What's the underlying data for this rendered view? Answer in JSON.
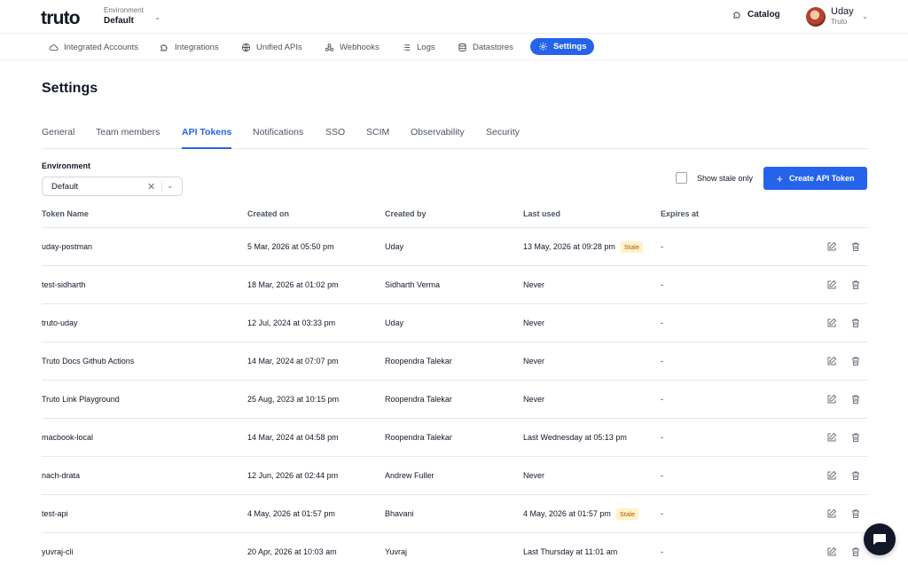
{
  "brand": {
    "logo_text": "truto"
  },
  "environment_switcher": {
    "label": "Environment",
    "value": "Default"
  },
  "header": {
    "catalog_label": "Catalog",
    "user": {
      "name": "Uday",
      "org": "Truto"
    }
  },
  "nav": {
    "items": [
      {
        "label": "Integrated Accounts",
        "icon": "cloud-icon"
      },
      {
        "label": "Integrations",
        "icon": "puzzle-icon"
      },
      {
        "label": "Unified APIs",
        "icon": "globe-icon"
      },
      {
        "label": "Webhooks",
        "icon": "webhook-icon"
      },
      {
        "label": "Logs",
        "icon": "list-icon"
      },
      {
        "label": "Datastores",
        "icon": "database-icon"
      },
      {
        "label": "Settings",
        "icon": "gear-icon",
        "active": true
      }
    ]
  },
  "page": {
    "title": "Settings"
  },
  "tabs": [
    {
      "label": "General"
    },
    {
      "label": "Team members"
    },
    {
      "label": "API Tokens",
      "active": true
    },
    {
      "label": "Notifications"
    },
    {
      "label": "SSO"
    },
    {
      "label": "SCIM"
    },
    {
      "label": "Observability"
    },
    {
      "label": "Security"
    }
  ],
  "filters": {
    "environment_label": "Environment",
    "environment_value": "Default",
    "show_stale_label": "Show stale only",
    "show_stale_checked": false
  },
  "create_button_label": "Create API Token",
  "table": {
    "columns": [
      "Token Name",
      "Created on",
      "Created by",
      "Last used",
      "Expires at"
    ],
    "rows": [
      {
        "name": "uday-postman",
        "created_on": "5 Mar, 2026 at 05:50 pm",
        "created_by": "Uday",
        "last_used": "13 May, 2026 at 09:28 pm",
        "stale_badge": "Stale",
        "expires": "-"
      },
      {
        "name": "test-sidharth",
        "created_on": "18 Mar, 2026 at 01:02 pm",
        "created_by": "Sidharth Verma",
        "last_used": "Never",
        "stale_badge": "",
        "expires": "-"
      },
      {
        "name": "truto-uday",
        "created_on": "12 Jul, 2024 at 03:33 pm",
        "created_by": "Uday",
        "last_used": "Never",
        "stale_badge": "",
        "expires": "-"
      },
      {
        "name": "Truto Docs Github Actions",
        "created_on": "14 Mar, 2024 at 07:07 pm",
        "created_by": "Roopendra Talekar",
        "last_used": "Never",
        "stale_badge": "",
        "expires": "-"
      },
      {
        "name": "Truto Link Playground",
        "created_on": "25 Aug, 2023 at 10:15 pm",
        "created_by": "Roopendra Talekar",
        "last_used": "Never",
        "stale_badge": "",
        "expires": "-"
      },
      {
        "name": "macbook-local",
        "created_on": "14 Mar, 2024 at 04:58 pm",
        "created_by": "Roopendra Talekar",
        "last_used": "Last Wednesday at 05:13 pm",
        "stale_badge": "",
        "expires": "-"
      },
      {
        "name": "nach-drata",
        "created_on": "12 Jun, 2026 at 02:44 pm",
        "created_by": "Andrew Fuller",
        "last_used": "Never",
        "stale_badge": "",
        "expires": "-"
      },
      {
        "name": "test-api",
        "created_on": "4 May, 2026 at 01:57 pm",
        "created_by": "Bhavani",
        "last_used": "4 May, 2026 at 01:57 pm",
        "stale_badge": "Stale",
        "expires": "-"
      },
      {
        "name": "yuvraj-cli",
        "created_on": "20 Apr, 2026 at 10:03 am",
        "created_by": "Yuvraj",
        "last_used": "Last Thursday at 11:01 am",
        "stale_badge": "",
        "expires": "-"
      }
    ]
  },
  "colors": {
    "accent": "#2563eb",
    "stale_bg": "#fdf3c7",
    "stale_text": "#b45309"
  }
}
